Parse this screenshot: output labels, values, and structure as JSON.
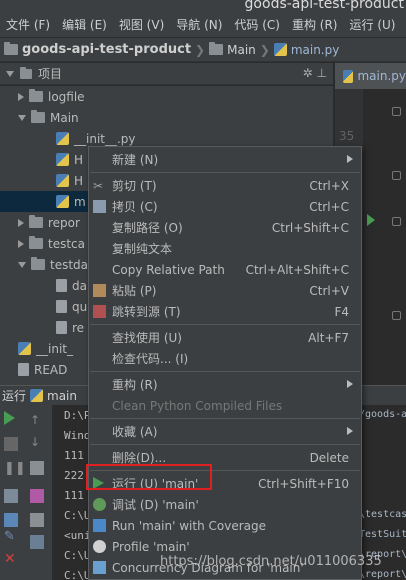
{
  "window": {
    "title": "goods-api-test-product"
  },
  "menubar": [
    "文件 (F)",
    "编辑 (E)",
    "视图 (V)",
    "导航 (N)",
    "代码 (C)",
    "重构 (R)",
    "运行 (U)",
    "工"
  ],
  "breadcrumb": [
    {
      "label": "goods-api-test-product",
      "icon": "folder-icon"
    },
    {
      "label": "Main",
      "icon": "folder-icon"
    },
    {
      "label": "main.py",
      "icon": "python-file-icon"
    }
  ],
  "project_panel": {
    "title": "项目"
  },
  "editor": {
    "tab_label": "main.py",
    "line_number": "35"
  },
  "tree": [
    {
      "label": "logfile",
      "indent": 1,
      "type": "folder",
      "expanded": false
    },
    {
      "label": "Main",
      "indent": 1,
      "type": "folder",
      "expanded": true
    },
    {
      "label": "__init__.py",
      "indent": 2,
      "type": "python"
    },
    {
      "label": "H",
      "indent": 2,
      "type": "python"
    },
    {
      "label": "H",
      "indent": 2,
      "type": "python"
    },
    {
      "label": "m",
      "indent": 2,
      "type": "python",
      "selected": true
    },
    {
      "label": "repor",
      "indent": 1,
      "type": "folder",
      "expanded": false
    },
    {
      "label": "testca",
      "indent": 1,
      "type": "folder",
      "expanded": false
    },
    {
      "label": "testda",
      "indent": 1,
      "type": "folder",
      "expanded": true
    },
    {
      "label": "da",
      "indent": 2,
      "type": "file"
    },
    {
      "label": "qu",
      "indent": 2,
      "type": "file"
    },
    {
      "label": "re",
      "indent": 2,
      "type": "file"
    },
    {
      "label": "__init_",
      "indent": 1,
      "type": "python"
    },
    {
      "label": "READ",
      "indent": 1,
      "type": "file"
    }
  ],
  "run_panel": {
    "label": "运行",
    "config": "main"
  },
  "console_left": [
    "D:\\P",
    "Wind",
    "111",
    "222",
    "111",
    "C:\\U",
    "<uni",
    "C:\\U",
    "C:\\U"
  ],
  "console_right": [
    "/goods-a",
    "",
    "",
    "",
    "",
    "\\testcas",
    "TestSuit",
    "\\report\\",
    "\\report\\"
  ],
  "context_menu": [
    {
      "label": "新建 (N)",
      "shortcut": "",
      "submenu": true,
      "icon": ""
    },
    {
      "sep": true
    },
    {
      "label": "剪切 (T)",
      "shortcut": "Ctrl+X",
      "icon": "cut-icon"
    },
    {
      "label": "拷贝 (C)",
      "shortcut": "Ctrl+C",
      "icon": "copy-icon"
    },
    {
      "label": "复制路径 (O)",
      "shortcut": "Ctrl+Shift+C",
      "icon": ""
    },
    {
      "label": "复制纯文本",
      "shortcut": "",
      "icon": ""
    },
    {
      "label": "Copy Relative Path",
      "shortcut": "Ctrl+Alt+Shift+C",
      "icon": ""
    },
    {
      "label": "粘贴 (P)",
      "shortcut": "Ctrl+V",
      "icon": "paste-icon"
    },
    {
      "label": "跳转到源 (T)",
      "shortcut": "F4",
      "icon": "jump-source-icon"
    },
    {
      "sep": true
    },
    {
      "label": "查找使用 (U)",
      "shortcut": "Alt+F7",
      "icon": ""
    },
    {
      "label": "检查代码... (I)",
      "shortcut": "",
      "icon": ""
    },
    {
      "sep": true
    },
    {
      "label": "重构 (R)",
      "shortcut": "",
      "submenu": true,
      "icon": ""
    },
    {
      "label": "Clean Python Compiled Files",
      "shortcut": "",
      "disabled": true,
      "icon": ""
    },
    {
      "sep": true
    },
    {
      "label": "收藏 (A)",
      "shortcut": "",
      "submenu": true,
      "icon": ""
    },
    {
      "sep": true
    },
    {
      "label": "删除(D)...",
      "shortcut": "Delete",
      "icon": ""
    },
    {
      "sep": true
    },
    {
      "label": "运行 (U) 'main'",
      "shortcut": "Ctrl+Shift+F10",
      "icon": "run-icon",
      "highlighted": true
    },
    {
      "label": "调试 (D) 'main'",
      "shortcut": "",
      "icon": "debug-icon"
    },
    {
      "label": "Run 'main' with Coverage",
      "shortcut": "",
      "icon": "coverage-icon"
    },
    {
      "label": "Profile 'main'",
      "shortcut": "",
      "icon": "profile-icon"
    },
    {
      "label": "Concurrency Diagram for 'main'",
      "shortcut": "",
      "icon": "concurrency-icon"
    }
  ],
  "watermark": "https://blog.csdn.net/u011006335",
  "colors": {
    "accent": "#4a88c7",
    "highlight_box": "#e02020",
    "run_green": "#499c54"
  }
}
